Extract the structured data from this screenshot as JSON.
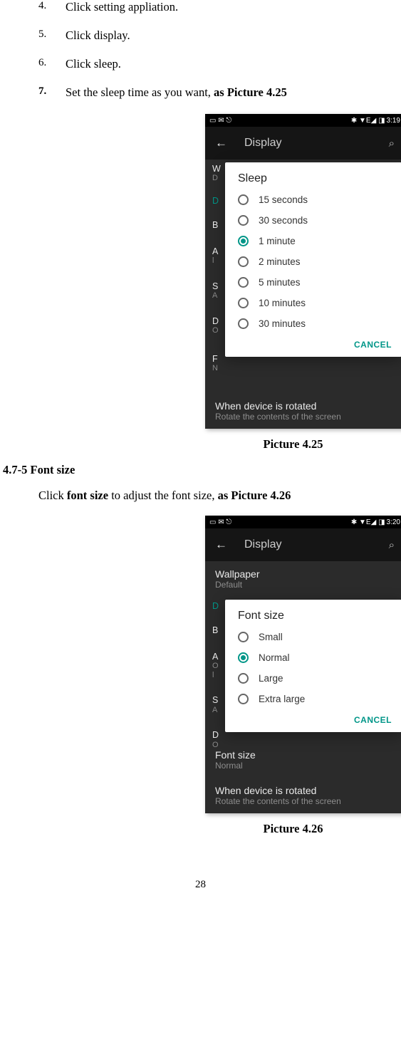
{
  "steps": [
    {
      "num": "4.",
      "text": "Click setting appliation.",
      "bold": false
    },
    {
      "num": "5.",
      "text": "Click display.",
      "bold": false
    },
    {
      "num": "6.",
      "text": "Click sleep.",
      "bold": false
    },
    {
      "num": "7.",
      "text_prefix": "Set the sleep time as you want, ",
      "text_bold": "as Picture 4.25",
      "bold": true
    }
  ],
  "caption1": "Picture 4.25",
  "heading": "4.7-5 Font size",
  "para_prefix": "Click ",
  "para_bold1": "font size",
  "para_mid": " to adjust the font size, ",
  "para_bold2": "as Picture 4.26",
  "caption2": "Picture 4.26",
  "page_number": "28",
  "screenshot1": {
    "time": "3:19",
    "status_icons_left": "▭ ✉ ⎋",
    "status_icons_right": "✱ ▼E◢ ◨",
    "toolbar_title": "Display",
    "dialog_title": "Sleep",
    "options": [
      "15 seconds",
      "30 seconds",
      "1 minute",
      "2 minutes",
      "5 minutes",
      "10 minutes",
      "30 minutes"
    ],
    "selected_index": 2,
    "cancel": "CANCEL",
    "bg_labels": {
      "W": "W",
      "D": "D",
      "D2": "D",
      "B": "B",
      "A": "A",
      "l": "l",
      "S": "S",
      "A2": "A",
      "D3": "D",
      "O": "O",
      "F": "F",
      "N": "N"
    },
    "footer_title": "When device is rotated",
    "footer_sub": "Rotate the contents of the screen"
  },
  "screenshot2": {
    "time": "3:20",
    "status_icons_left": "▭ ✉ ⎋",
    "status_icons_right": "✱ ▼E◢ ◨",
    "toolbar_title": "Display",
    "top_item_title": "Wallpaper",
    "top_item_sub": "Default",
    "dialog_title": "Font size",
    "options": [
      "Small",
      "Normal",
      "Large",
      "Extra large"
    ],
    "selected_index": 1,
    "cancel": "CANCEL",
    "bg_labels": {
      "D": "D",
      "B": "B",
      "A": "A",
      "O": "O",
      "l": "l",
      "S": "S",
      "A2": "A",
      "D2": "D",
      "O2": "O"
    },
    "font_title": "Font size",
    "font_sub": "Normal",
    "footer_title": "When device is rotated",
    "footer_sub": "Rotate the contents of the screen"
  }
}
